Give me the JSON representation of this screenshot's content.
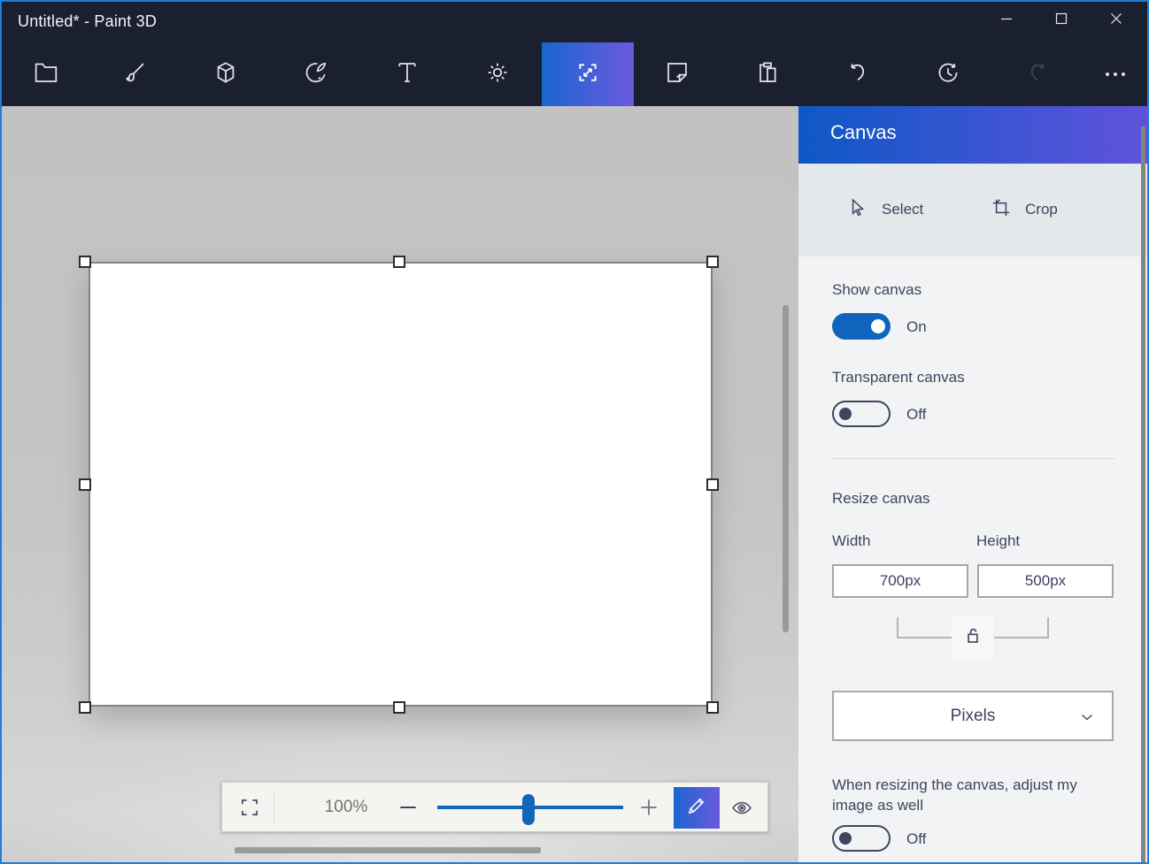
{
  "window": {
    "title": "Untitled* - Paint 3D"
  },
  "titlebar": {
    "controls": [
      {
        "name": "minimize"
      },
      {
        "name": "maximize"
      },
      {
        "name": "close"
      }
    ]
  },
  "toolbar": {
    "items": [
      {
        "icon": "menu-folder",
        "selected": false
      },
      {
        "icon": "brushes",
        "selected": false
      },
      {
        "icon": "3d-shapes",
        "selected": false
      },
      {
        "icon": "2d-shapes",
        "selected": false
      },
      {
        "icon": "text",
        "selected": false
      },
      {
        "icon": "effects",
        "selected": false
      },
      {
        "icon": "canvas",
        "selected": true
      },
      {
        "icon": "stickers",
        "selected": false
      },
      {
        "icon": "paste",
        "selected": false
      },
      {
        "icon": "undo",
        "selected": false
      },
      {
        "icon": "history",
        "selected": false
      },
      {
        "icon": "redo",
        "selected": false,
        "disabled": true
      },
      {
        "icon": "more",
        "selected": false
      }
    ]
  },
  "panel": {
    "title": "Canvas",
    "tools": {
      "select": "Select",
      "crop": "Crop"
    },
    "show_canvas": {
      "label": "Show canvas",
      "state": "On"
    },
    "transparent_canvas": {
      "label": "Transparent canvas",
      "state": "Off"
    },
    "resize": {
      "heading": "Resize canvas",
      "width_label": "Width",
      "height_label": "Height",
      "width_value": "700px",
      "height_value": "500px",
      "aspect_lock": "unlocked",
      "units_value": "Pixels"
    },
    "adjust_image": {
      "label": "When resizing the canvas, adjust my image as well",
      "state": "Off"
    }
  },
  "zoombar": {
    "zoom_value": "100%"
  },
  "canvas_selection": {
    "handles": 8,
    "size": "700x500 at 100%"
  },
  "colors": {
    "accent_blue": "#0f65bd",
    "gradient_start": "#1a66d0",
    "gradient_end": "#6c59de",
    "titlebar_bg": "#1a2030",
    "panel_bg": "#f2f3f4",
    "panel_text": "#3f445f"
  }
}
